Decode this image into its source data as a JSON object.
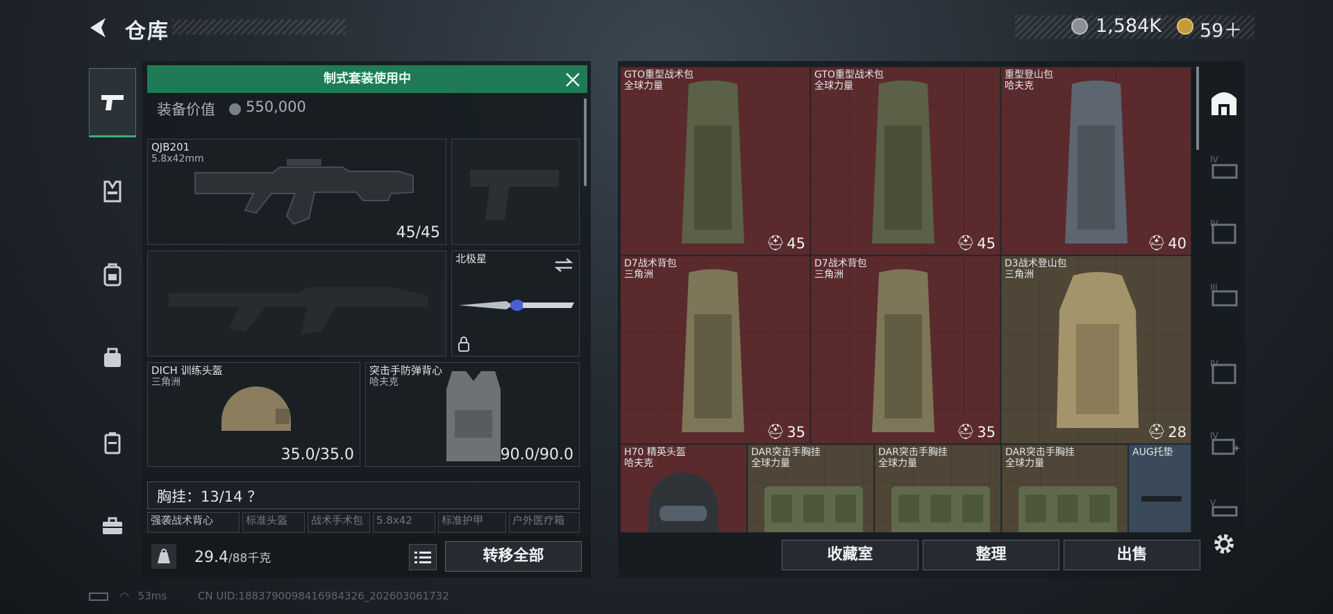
{
  "header": {
    "title": "仓库",
    "currency_1": "1,584K",
    "currency_2": "59＋"
  },
  "banner": {
    "text": "制式套装使用中"
  },
  "equipment_value": {
    "label": "装备价值",
    "value": "550,000"
  },
  "slots": {
    "primary": {
      "name": "QJB201",
      "sub": "5.8x42mm",
      "value": "45/45"
    },
    "melee": {
      "name": "北极星"
    },
    "helmet": {
      "name": "DICH 训练头盔",
      "sub": "三角洲",
      "value": "35.0/35.0"
    },
    "armor": {
      "name": "突击手防弹背心",
      "sub": "哈夫克",
      "value": "90.0/90.0"
    }
  },
  "chest": {
    "label": "胸挂：13/14 ？",
    "chips": [
      "强袭战术背心",
      "标准头盔",
      "战术手术包",
      "5.8x42",
      "标准护甲",
      "户外医疗箱"
    ]
  },
  "footer": {
    "weight": "29.4",
    "weight_unit": "/88千克",
    "transfer_label": "转移全部"
  },
  "grid": {
    "items": [
      {
        "name": "GTO重型战术包",
        "sub": "全球力量",
        "count": "45",
        "color": "red"
      },
      {
        "name": "GTO重型战术包",
        "sub": "全球力量",
        "count": "45",
        "color": "red"
      },
      {
        "name": "重型登山包",
        "sub": "哈夫克",
        "count": "40",
        "color": "red"
      },
      {
        "name": "D7战术背包",
        "sub": "三角洲",
        "count": "35",
        "color": "red"
      },
      {
        "name": "D7战术背包",
        "sub": "三角洲",
        "count": "35",
        "color": "red"
      },
      {
        "name": "D3战术登山包",
        "sub": "三角洲",
        "count": "28",
        "color": "tan"
      },
      {
        "name": "H70 精英头盔",
        "sub": "哈夫克",
        "count": "",
        "color": "red"
      },
      {
        "name": "DAR突击手胸挂",
        "sub": "全球力量",
        "count": "",
        "color": "tan"
      },
      {
        "name": "DAR突击手胸挂",
        "sub": "全球力量",
        "count": "",
        "color": "tan"
      },
      {
        "name": "DAR突击手胸挂",
        "sub": "全球力量",
        "count": "",
        "color": "tan"
      },
      {
        "name": "AUG托垫",
        "sub": "",
        "count": "",
        "color": "blue"
      }
    ]
  },
  "right_rail": {
    "tiers": [
      "IV",
      "IV",
      "III",
      "IV",
      "IV",
      "V"
    ]
  },
  "bottom_buttons": {
    "collection": "收藏室",
    "organize": "整理",
    "sell": "出售"
  },
  "status": {
    "ping": "53ms",
    "uid": "CN UID:1883790098416984326_202603061732"
  },
  "colors": {
    "accent_green": "#1f7a55",
    "red_item": "#5b2a2d",
    "tan_item": "#4f4637",
    "blue_item": "#3a4a5a"
  }
}
